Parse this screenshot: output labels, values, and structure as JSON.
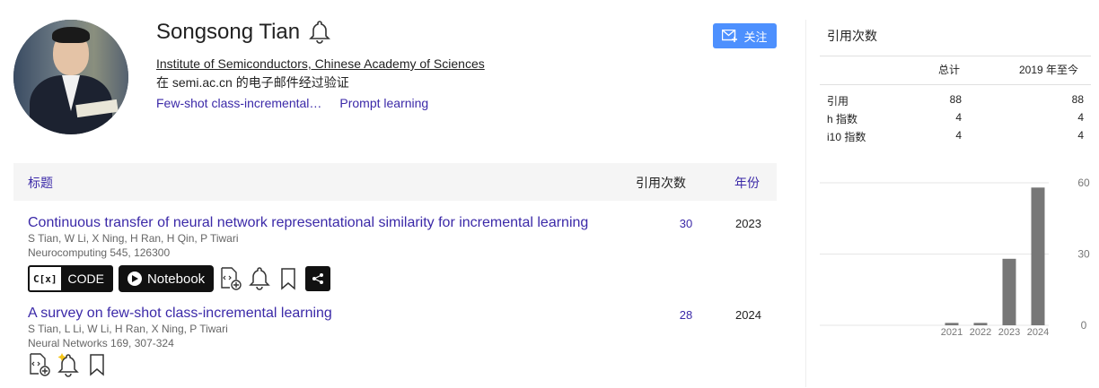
{
  "profile": {
    "name": "Songsong Tian",
    "affiliation": "Institute of Semiconductors, Chinese Academy of Sciences",
    "verified": "在 semi.ac.cn 的电子邮件经过验证",
    "interests": [
      "Few-shot class-incremental…",
      "Prompt learning"
    ],
    "follow_label": "关注"
  },
  "table": {
    "header_title": "标题",
    "header_cited": "引用次数",
    "header_year": "年份"
  },
  "papers": [
    {
      "title": "Continuous transfer of neural network representational similarity for incremental learning",
      "authors": "S Tian, W Li, X Ning, H Ran, H Qin, P Tiwari",
      "venue": "Neurocomputing 545, 126300",
      "cited": "30",
      "year": "2023",
      "code_label": "CODE",
      "code_prefix": "C[x]",
      "notebook_label": "Notebook"
    },
    {
      "title": "A survey on few-shot class-incremental learning",
      "authors": "S Tian, L Li, W Li, H Ran, X Ning, P Tiwari",
      "venue": "Neural Networks 169, 307-324",
      "cited": "28",
      "year": "2024"
    }
  ],
  "citations": {
    "title": "引用次数",
    "col_total": "总计",
    "col_since": "2019 年至今",
    "rows": [
      {
        "label": "引用",
        "total": "88",
        "since": "88"
      },
      {
        "label": "h 指数",
        "total": "4",
        "since": "4"
      },
      {
        "label": "i10 指数",
        "total": "4",
        "since": "4"
      }
    ]
  },
  "chart_data": {
    "type": "bar",
    "categories": [
      "2021",
      "2022",
      "2023",
      "2024"
    ],
    "values": [
      1,
      1,
      28,
      58
    ],
    "ylim": [
      0,
      60
    ],
    "yticks": [
      0,
      30,
      60
    ],
    "grid": true,
    "color": "#777777"
  },
  "colors": {
    "link": "#3b29a8",
    "follow_button": "#4d90fe"
  }
}
